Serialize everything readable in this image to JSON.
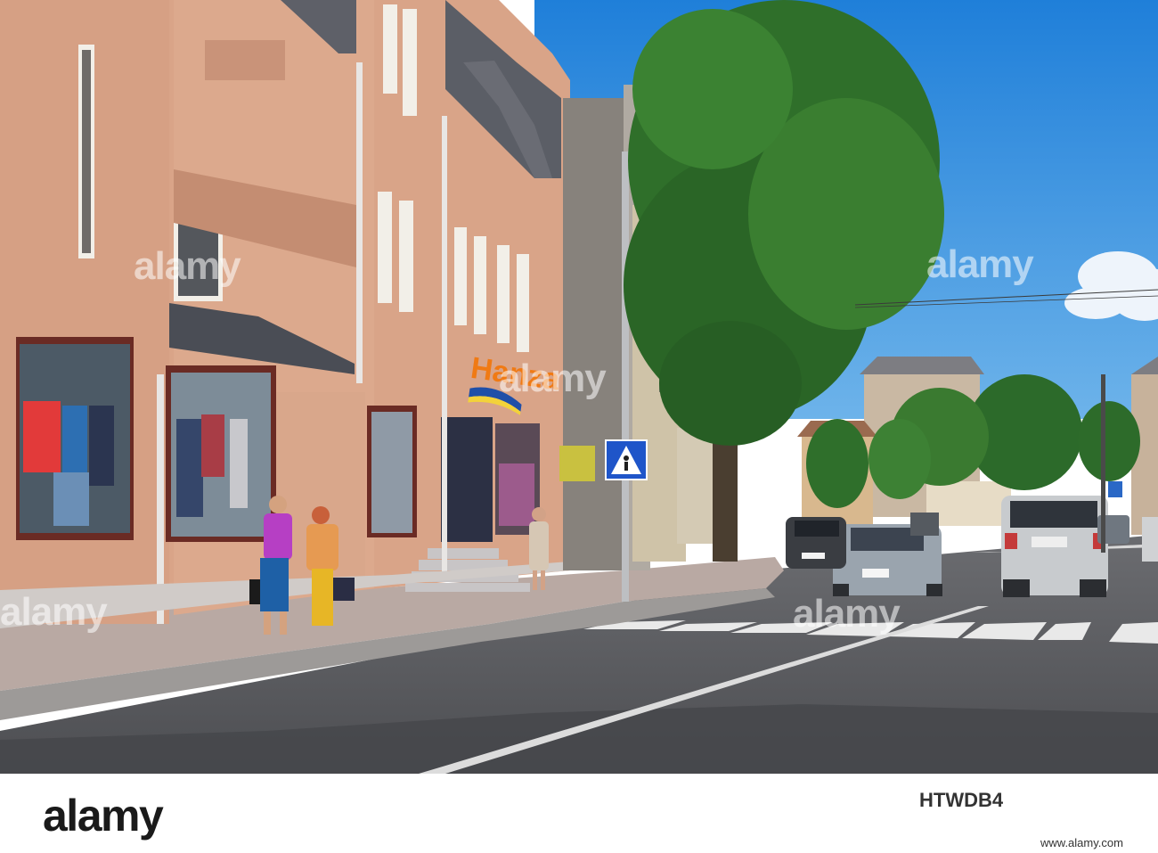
{
  "photo": {
    "shop_sign": "Hanza",
    "road_sign_kind": "pedestrian-crossing-sign",
    "colors": {
      "sky": "#2f8de0",
      "facade": "#d9a488",
      "tree": "#2f6f2a",
      "road": "#5b5c60"
    }
  },
  "watermark": {
    "text": "alamy"
  },
  "footer": {
    "logo": "alamy",
    "image_id": "HTWDB4",
    "site": "www.alamy.com"
  }
}
